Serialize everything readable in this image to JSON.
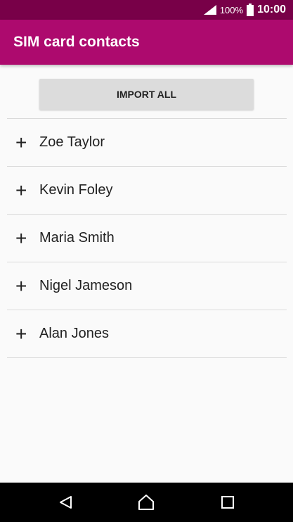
{
  "status_bar": {
    "battery_percent": "100%",
    "time": "10:00",
    "icons": [
      "signal-icon",
      "battery-icon"
    ]
  },
  "app_bar": {
    "title": "SIM card contacts",
    "color": "#ad0a6e"
  },
  "import_button": {
    "label": "IMPORT ALL"
  },
  "contacts": [
    {
      "name": "Zoe Taylor",
      "icon": "plus-icon"
    },
    {
      "name": "Kevin Foley",
      "icon": "plus-icon"
    },
    {
      "name": "Maria Smith",
      "icon": "plus-icon"
    },
    {
      "name": "Nigel Jameson",
      "icon": "plus-icon"
    },
    {
      "name": "Alan Jones",
      "icon": "plus-icon"
    }
  ],
  "nav_bar": {
    "buttons": [
      "back-icon",
      "home-icon",
      "recents-icon"
    ]
  }
}
